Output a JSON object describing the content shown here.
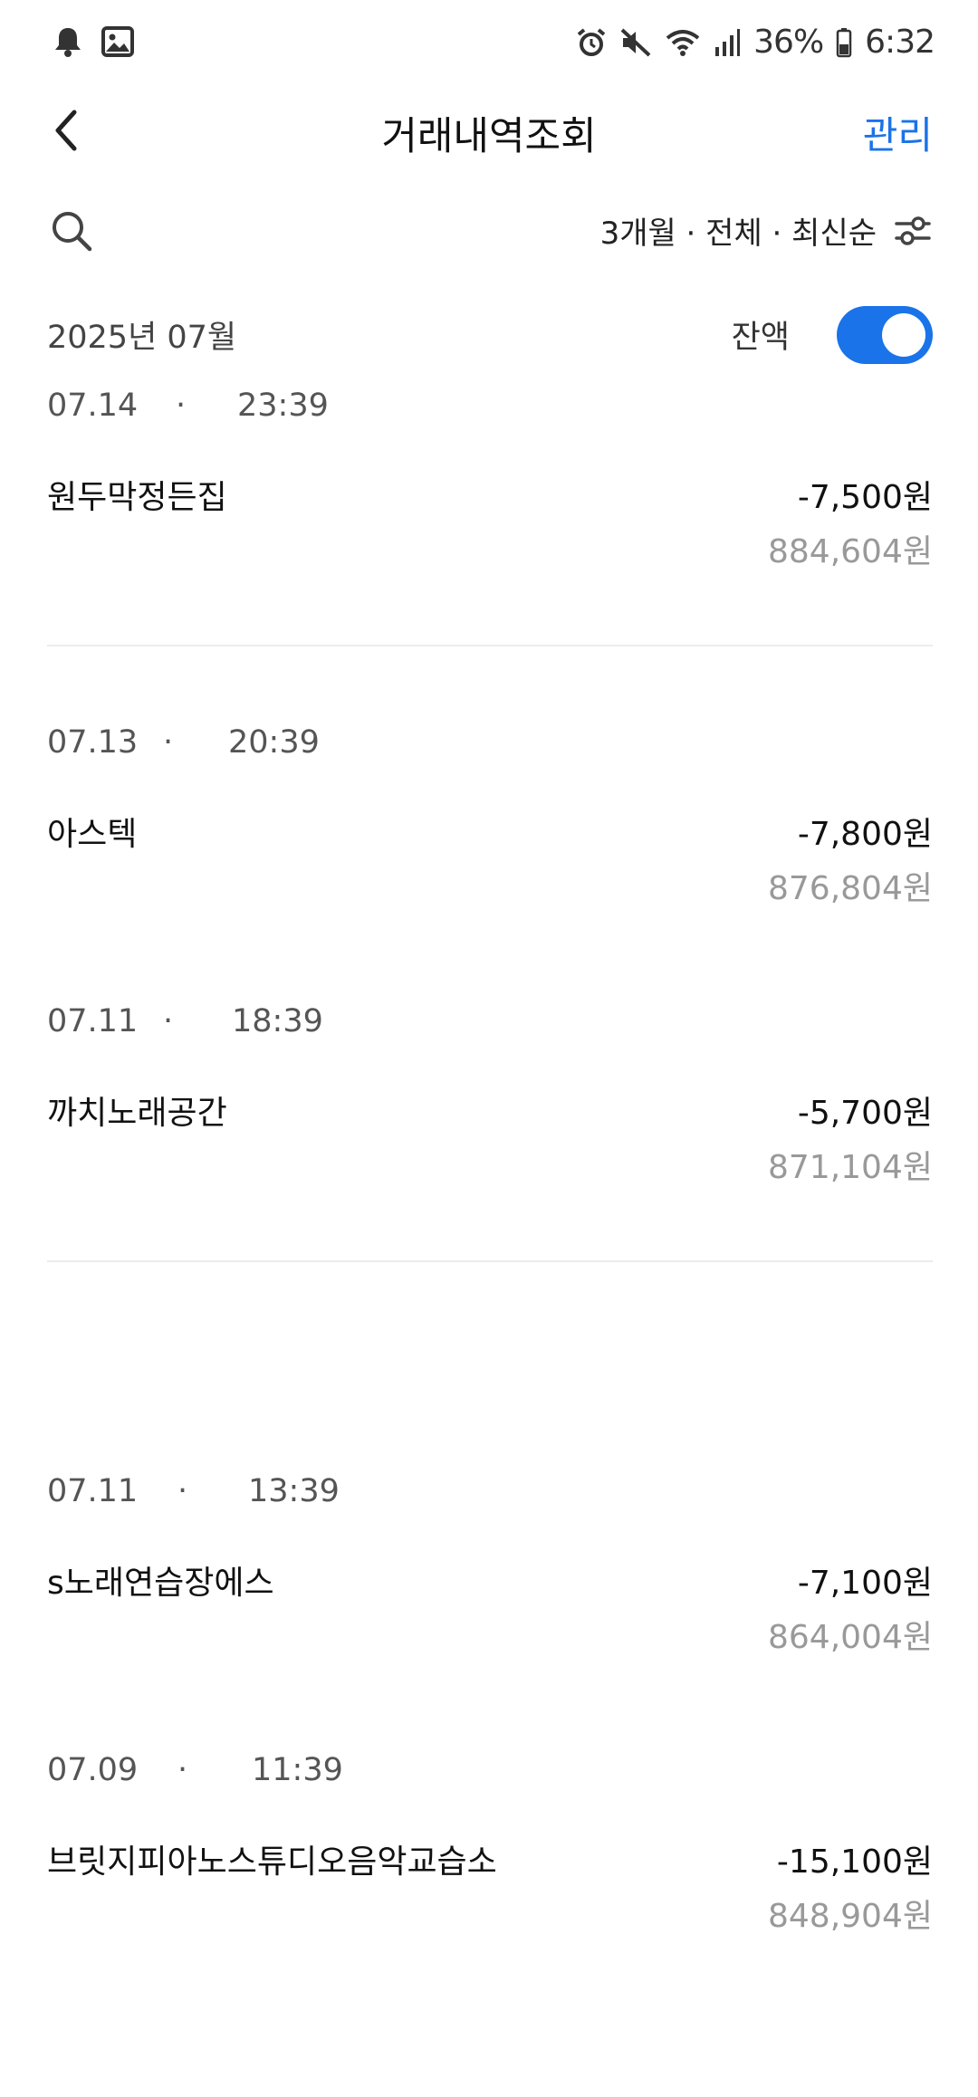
{
  "status_bar": {
    "battery": "36%",
    "time": "6:32",
    "icons": [
      "notification-bell-icon",
      "gallery-icon",
      "alarm-icon",
      "mute-icon",
      "wifi-icon",
      "signal-icon",
      "battery-icon"
    ]
  },
  "header": {
    "title": "거래내역조회",
    "manage_label": "관리",
    "accent_color": "#1a73e8"
  },
  "filter": {
    "label": "3개월 · 전체 · 최신순"
  },
  "month": {
    "label": "2025년 07월",
    "balance_toggle_label": "잔액",
    "balance_toggle_on": true
  },
  "transactions": [
    {
      "date": "07.14",
      "separator": "·",
      "time": "23:39",
      "name": "원두막정든집",
      "amount": "-7,500원",
      "balance": "884,604원"
    },
    {
      "date": "07.13",
      "separator": "·",
      "time": "20:39",
      "name": "아스텍",
      "amount": "-7,800원",
      "balance": "876,804원"
    },
    {
      "date": "07.11",
      "separator": "·",
      "time": "18:39",
      "name": "까치노래공간",
      "amount": "-5,700원",
      "balance": "871,104원"
    },
    {
      "date": "07.11",
      "separator": "·",
      "time": "13:39",
      "name": "s노래연습장에스",
      "amount": "-7,100원",
      "balance": "864,004원"
    },
    {
      "date": "07.09",
      "separator": "·",
      "time": "11:39",
      "name": "브릿지피아노스튜디오음악교습소",
      "amount": "-15,100원",
      "balance": "848,904원"
    }
  ]
}
